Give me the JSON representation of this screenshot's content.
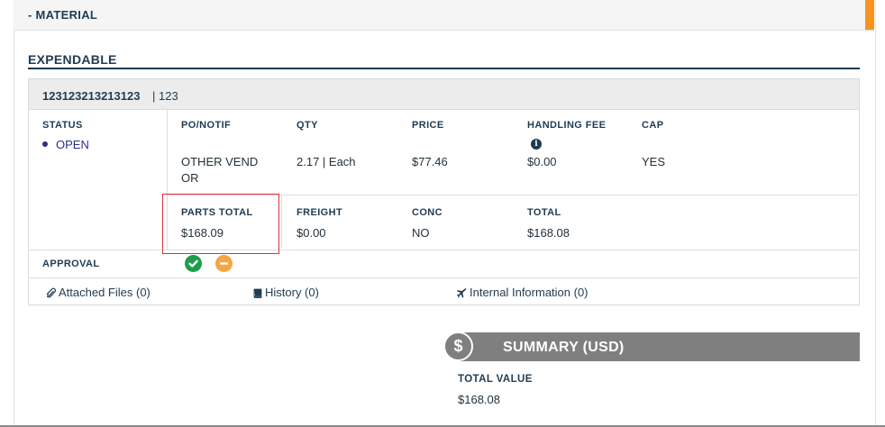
{
  "section": {
    "title": "- MATERIAL"
  },
  "expendable": {
    "title": "EXPENDABLE"
  },
  "part": {
    "number": "123123213213123",
    "separator_value": "| 123"
  },
  "status": {
    "label": "STATUS",
    "value": "OPEN"
  },
  "columns_row1": {
    "po_notif": {
      "label": "PO/NOTIF",
      "value_line1": "OTHER VEND",
      "value_line2": "OR"
    },
    "qty": {
      "label": "QTY",
      "value": "2.17 | Each"
    },
    "price": {
      "label": "PRICE",
      "value": "$77.46"
    },
    "handling_fee": {
      "label": "HANDLING FEE",
      "value": "$0.00",
      "info_glyph": "i"
    },
    "cap": {
      "label": "CAP",
      "value": "YES"
    }
  },
  "columns_row2": {
    "parts_total": {
      "label": "PARTS TOTAL",
      "value": "$168.09"
    },
    "freight": {
      "label": "FREIGHT",
      "value": "$0.00"
    },
    "conc": {
      "label": "CONC",
      "value": "NO"
    },
    "total": {
      "label": "TOTAL",
      "value": "$168.08"
    }
  },
  "approval": {
    "label": "APPROVAL",
    "approved_icon": "check-circle-icon",
    "pending_icon": "minus-circle-icon"
  },
  "links": {
    "attached_files": "Attached Files (0)",
    "history": "History (0)",
    "internal_information": "Internal Information (0)"
  },
  "summary": {
    "title": "SUMMARY (USD)",
    "currency_glyph": "$",
    "total_value_label": "TOTAL VALUE",
    "total_value": "$168.08"
  },
  "colors": {
    "accent": "#f7931e",
    "heading": "#1f3b52",
    "status_dot": "#2a2f8f",
    "approved": "#1e9e4a",
    "pending": "#f5a542",
    "highlight": "#d9313a",
    "summary_bar": "#7f7f7f"
  }
}
